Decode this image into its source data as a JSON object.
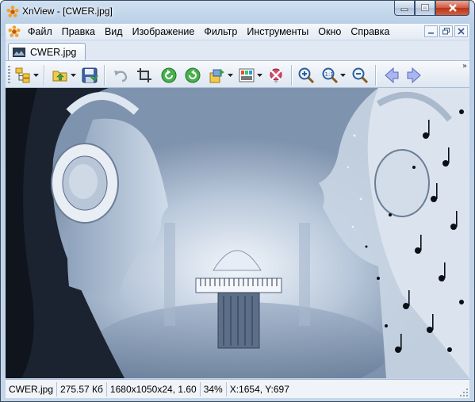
{
  "window": {
    "title": "XnView - [CWER.jpg]"
  },
  "menu": {
    "items": [
      "Файл",
      "Правка",
      "Вид",
      "Изображение",
      "Фильтр",
      "Инструменты",
      "Окно",
      "Справка"
    ]
  },
  "tabs": [
    {
      "label": "CWER.jpg",
      "active": true
    }
  ],
  "toolbar": {
    "buttons": [
      "browser-icon",
      "open-folder-icon",
      "save-icon",
      "undo-icon",
      "crop-icon",
      "rotate-left-icon",
      "rotate-right-icon",
      "convert-icon",
      "adjust-icon",
      "remove-redeye-icon",
      "zoom-in-icon",
      "zoom-fit-icon",
      "zoom-out-icon",
      "previous-image-icon",
      "next-image-icon"
    ],
    "overflow_glyph": "»"
  },
  "status": {
    "filename": "CWER.jpg",
    "filesize": "275.57 Кб",
    "dimensions": "1680x1050x24, 1.60",
    "zoom": "34%",
    "coords": "X:1654, Y:697"
  },
  "colors": {
    "window_frame": "#c4d6ea",
    "toolbar_bg": "#e6edf6",
    "image_tone": "#8ea3bd",
    "close_button": "#c8452b"
  }
}
